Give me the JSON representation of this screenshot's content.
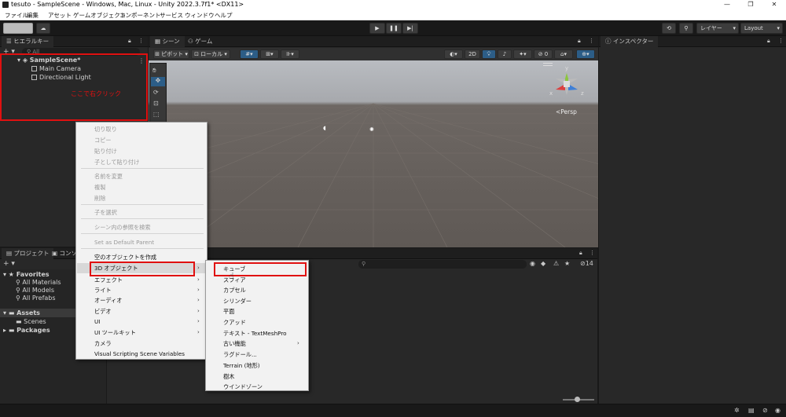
{
  "window": {
    "title": "tesuto - SampleScene - Windows, Mac, Linux - Unity 2022.3.7f1* <DX11>"
  },
  "menubar": {
    "items": [
      "ファイル",
      "編集",
      "アセット",
      "ゲームオブジェクト",
      "コンポーネント",
      "サービス",
      "ウィンドウ",
      "ヘルプ"
    ]
  },
  "toolbar": {
    "layers_label": "レイヤー",
    "layout_label": "Layout"
  },
  "hierarchy": {
    "tab": "ヒエラルキー",
    "search_placeholder": "All",
    "scene": "SampleScene*",
    "items": [
      "Main Camera",
      "Directional Light"
    ],
    "annotation": "ここで右クリック"
  },
  "scene_view": {
    "tabs": [
      "シーン",
      "ゲーム"
    ],
    "pivot_label": "ピボット",
    "local_label": "ローカル",
    "mode_2d": "2D",
    "persp_label": "<Persp",
    "gizmo_axes": [
      "y",
      "x",
      "z"
    ]
  },
  "inspector": {
    "tab": "インスペクター"
  },
  "project": {
    "tabs": [
      "プロジェクト",
      "コンソール"
    ],
    "favorites_label": "Favorites",
    "favorites": [
      "All Materials",
      "All Models",
      "All Prefabs"
    ],
    "assets_label": "Assets",
    "scenes_label": "Scenes",
    "packages_label": "Packages",
    "count": "14"
  },
  "context_menu": {
    "group1": [
      "切り取り",
      "コピー",
      "貼り付け",
      "子として貼り付け"
    ],
    "group2": [
      "名前を変更",
      "複製",
      "削除"
    ],
    "group3": [
      "子を選択"
    ],
    "group4": [
      "シーン内の参照を検索"
    ],
    "group5": [
      "Set as Default Parent"
    ],
    "create_empty": "空のオブジェクトを作成",
    "submenus": [
      "3D オブジェクト",
      "エフェクト",
      "ライト",
      "オーディオ",
      "ビデオ",
      "UI",
      "UI ツールキット"
    ],
    "camera": "カメラ",
    "visual_scripting": "Visual Scripting Scene Variables"
  },
  "submenu_3d": {
    "items": [
      "キューブ",
      "スフィア",
      "カプセル",
      "シリンダー",
      "平面",
      "クアッド",
      "テキスト - TextMeshPro",
      "古い機能",
      "ラグドール...",
      "Terrain (地形)",
      "樹木",
      "ウインドゾーン"
    ]
  },
  "colors": {
    "highlight": "#e01010",
    "accent": "#2c5d87"
  }
}
